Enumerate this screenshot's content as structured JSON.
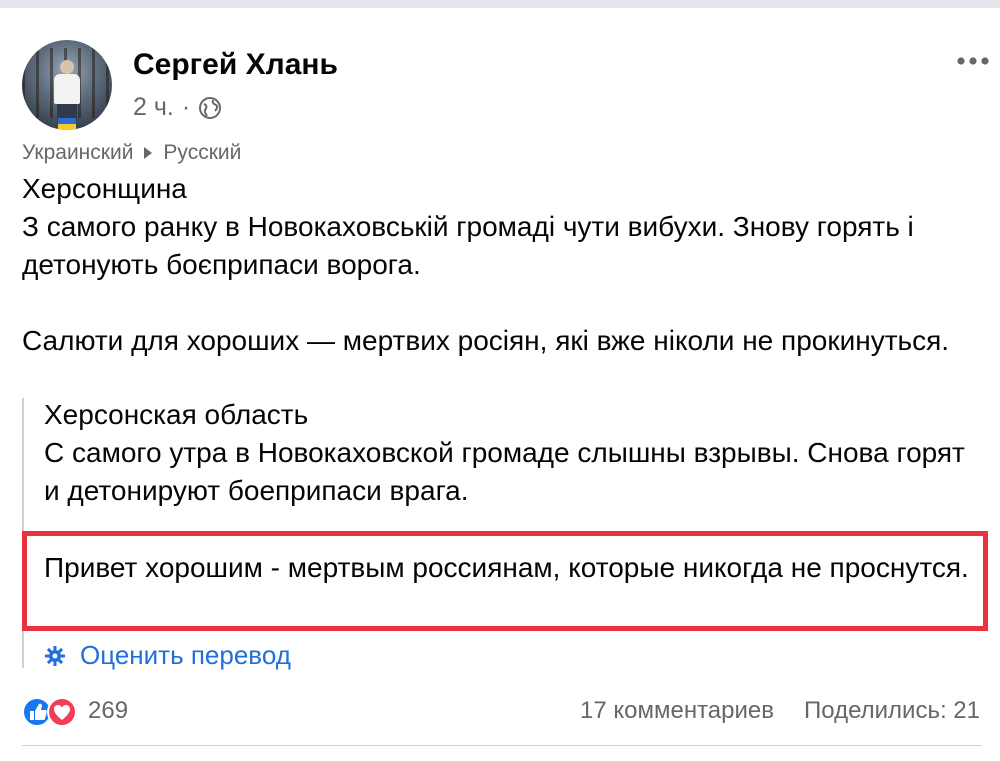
{
  "post": {
    "author": "Сергей Хлань",
    "time": "2 ч.",
    "separator": "·",
    "translation": {
      "from": "Украинский",
      "to": "Русский"
    },
    "original": {
      "line1": "Херсонщина",
      "line2": "З самого ранку в Новокаховській громаді чути вибухи. Знову горять і детонують боєприпаси ворога.",
      "line3": "Салюти для хороших — мертвих росіян, які вже ніколи не прокинуться."
    },
    "translated": {
      "line1": "Херсонская область",
      "line2": "С самого утра в Новокаховской громаде слышны взрывы. Снова горят и детонируют боеприпаси врага.",
      "line3": "Привет хорошим - мертвым россиянам, которые никогда не проснутся."
    },
    "rate_translation": "Оценить перевод",
    "reactions_count": "269",
    "comments": "17 комментариев",
    "shares": "Поделились: 21"
  },
  "icons": {
    "globe": "globe-icon",
    "more": "more-icon",
    "arrow": "arrow-right-icon",
    "gear": "gear-icon",
    "like": "like-icon",
    "love": "love-icon"
  },
  "colors": {
    "highlight_border": "#e8323f",
    "link": "#216fdb",
    "muted": "#65676b",
    "like": "#1877f2",
    "love": "#f33e58"
  }
}
